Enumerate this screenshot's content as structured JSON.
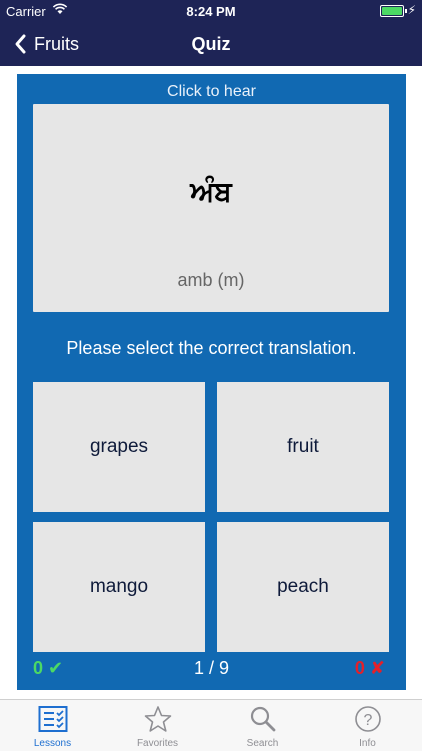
{
  "status": {
    "carrier": "Carrier",
    "time": "8:24 PM"
  },
  "nav": {
    "back_label": "Fruits",
    "title": "Quiz"
  },
  "quiz": {
    "hear_label": "Click to hear",
    "word": "ਅੰਬ",
    "transliteration": "amb (m)",
    "prompt": "Please select the correct translation.",
    "options": [
      "grapes",
      "fruit",
      "mango",
      "peach"
    ],
    "correct_count": "0 ✔",
    "progress": "1 / 9",
    "wrong_count": "0 ✘"
  },
  "tabs": [
    {
      "label": "Lessons",
      "icon": "lessons-icon",
      "active": true
    },
    {
      "label": "Favorites",
      "icon": "star-icon",
      "active": false
    },
    {
      "label": "Search",
      "icon": "search-icon",
      "active": false
    },
    {
      "label": "Info",
      "icon": "info-icon",
      "active": false
    }
  ],
  "colors": {
    "nav_bg": "#1e2456",
    "card_bg": "#1169b2",
    "option_bg": "#e6e6e6",
    "correct": "#4cd964",
    "wrong": "#e3202a",
    "tab_active": "#1e6fd0"
  }
}
